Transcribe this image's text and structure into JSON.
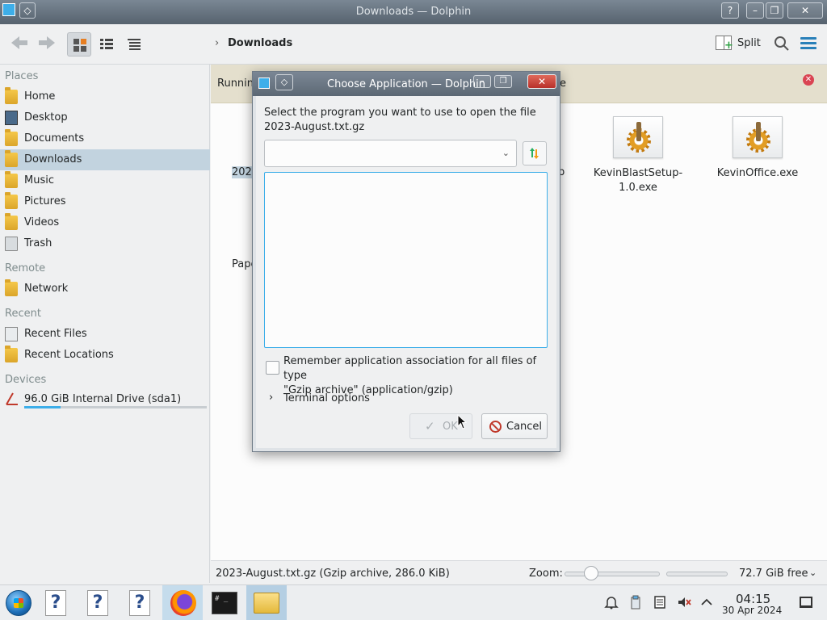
{
  "window": {
    "title": "Downloads — Dolphin",
    "help_btn": "?",
    "min_btn": "–",
    "max_btn": "❐",
    "close_btn": "✕",
    "pin_btn": "◇"
  },
  "toolbar": {
    "back_icon": "arrow-left-icon",
    "forward_icon": "arrow-right-icon",
    "breadcrumb_chevron": "›",
    "breadcrumb": "Downloads",
    "split_label": "Split"
  },
  "sidebar": {
    "sections": {
      "places": "Places",
      "remote": "Remote",
      "recent": "Recent",
      "devices": "Devices"
    },
    "places": [
      {
        "label": "Home"
      },
      {
        "label": "Desktop"
      },
      {
        "label": "Documents"
      },
      {
        "label": "Downloads"
      },
      {
        "label": "Music"
      },
      {
        "label": "Pictures"
      },
      {
        "label": "Videos"
      },
      {
        "label": "Trash"
      }
    ],
    "remote": [
      {
        "label": "Network"
      }
    ],
    "recent": [
      {
        "label": "Recent Files"
      },
      {
        "label": "Recent Locations"
      }
    ],
    "devices": [
      {
        "label": "96.0 GiB Internal Drive (sda1)",
        "usage_fraction": 0.2
      }
    ]
  },
  "main": {
    "notice_text": "Running",
    "notice_close": "✕",
    "files": [
      {
        "name": "KevinBlastSetup-1.0.exe"
      },
      {
        "name": "KevinOffice.exe"
      }
    ],
    "partial_labels": {
      "selected_file": "2023",
      "fragment_right": "p",
      "fragment_paper": "Pape",
      "notice_fragment_mid": "n",
      "notice_fragment_end": "e"
    }
  },
  "statusbar": {
    "info": "2023-August.txt.gz (Gzip archive, 286.0 KiB)",
    "zoom_label": "Zoom:",
    "free_space": "72.7 GiB free",
    "free_chevron": "⌄"
  },
  "dialog": {
    "title": "Choose Application — Dolphin",
    "prompt_line1": "Select the program you want to use to open the file",
    "prompt_line2": "2023-August.txt.gz",
    "combo_value": "",
    "combo_arrow": "⌄",
    "remember_line1": "Remember application association for all files of type",
    "remember_line2": "\"Gzip archive\" (application/gzip)",
    "terminal_chevron": "›",
    "terminal_label": "Terminal options",
    "ok_label": "OK",
    "ok_check": "✓",
    "cancel_label": "Cancel"
  },
  "taskbar": {
    "help_glyph": "?",
    "terminal_text": "# _",
    "clock_time": "04:15",
    "clock_date": "30 Apr 2024",
    "tray": {
      "notifications_icon": "bell-icon",
      "clipboard_icon": "clipboard-icon",
      "volume_icon": "volume-muted-icon",
      "expand_icon": "chevron-up-icon"
    }
  }
}
